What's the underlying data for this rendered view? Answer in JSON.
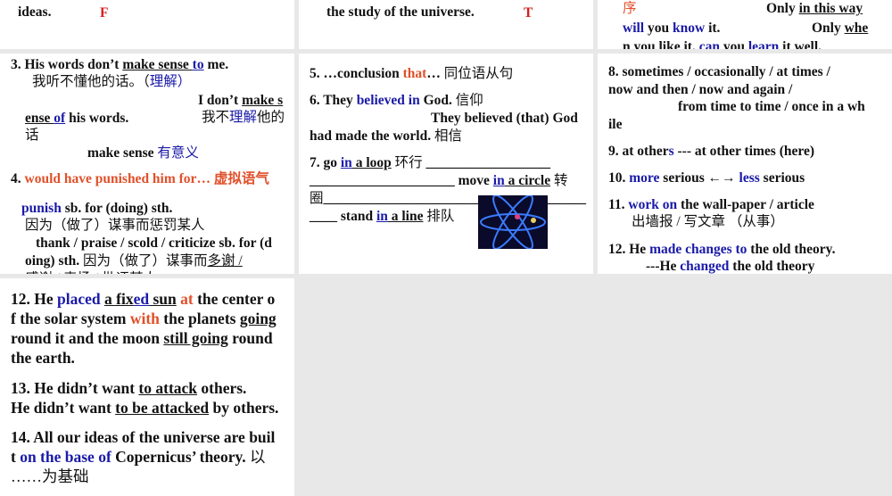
{
  "colors": {
    "blue": "#1a1aa8",
    "orange": "#e0502a",
    "red": "#d42020"
  },
  "panel_a": [
    [
      [
        "ideas.",
        ""
      ]
    ],
    [
      [
        "F",
        "r"
      ]
    ]
  ],
  "panel_b": [
    [
      [
        "the study of the universe.",
        ""
      ]
    ],
    [
      [
        "T",
        "r"
      ]
    ]
  ],
  "panel_c": [
    [
      [
        "序",
        "o cn"
      ]
    ],
    [
      [
        "Only ",
        ""
      ],
      [
        "in this way",
        "u"
      ]
    ],
    [
      [
        "will",
        "b"
      ],
      [
        " you ",
        ""
      ],
      [
        "know",
        "b"
      ],
      [
        " it.",
        ""
      ]
    ],
    [
      [
        "Only ",
        ""
      ],
      [
        "whe",
        "u"
      ]
    ],
    [
      [
        "n you like it, ",
        ""
      ],
      [
        "can",
        "b"
      ],
      [
        " you ",
        ""
      ],
      [
        "learn",
        "b"
      ],
      [
        " it well.",
        ""
      ]
    ]
  ],
  "panel_d": [
    [
      [
        "3. His words don’t ",
        ""
      ],
      [
        "make sense ",
        "u"
      ],
      [
        "to",
        "bu"
      ],
      [
        " me.",
        ""
      ]
    ],
    [
      [
        "我听不懂他的话。（",
        "cn"
      ],
      [
        "理解",
        "b cn"
      ],
      [
        "）",
        "b cn"
      ]
    ],
    [
      [
        "I don’t ",
        ""
      ],
      [
        "make s",
        "u"
      ]
    ],
    [
      [
        "ense ",
        "u"
      ],
      [
        "of",
        "bu"
      ],
      [
        " his words.",
        ""
      ]
    ],
    [
      [
        "我不",
        "cn"
      ],
      [
        "理解",
        "b cn"
      ],
      [
        "他的",
        "cn"
      ]
    ],
    [
      [
        "话",
        "cn"
      ]
    ],
    [
      [
        "make sense    ",
        ""
      ],
      [
        "有意义",
        "b cn"
      ]
    ],
    [
      [
        "4. ",
        ""
      ],
      [
        "would have punished him for… 虚拟语气",
        "o"
      ]
    ],
    [
      [
        "punish",
        "b"
      ],
      [
        " sb. for (doing) sth.",
        ""
      ]
    ],
    [
      [
        "因为（做了）谋事而惩罚某人",
        "cn"
      ]
    ],
    [
      [
        "thank / praise / scold / criticize sb. for (d",
        ""
      ]
    ],
    [
      [
        "oing) sth. ",
        ""
      ],
      [
        "因为（做了）谋事而",
        "cn"
      ],
      [
        "多谢  /",
        "u cn"
      ]
    ],
    [
      [
        "感谢 / 表扬 / 批评某人",
        "cn"
      ]
    ]
  ],
  "panel_e": [
    [
      [
        "5. …conclusion ",
        ""
      ],
      [
        "that",
        "o"
      ],
      [
        "… ",
        ""
      ],
      [
        "同位语从句",
        "cn"
      ]
    ],
    [
      [
        "6. They ",
        ""
      ],
      [
        "believed in",
        "b"
      ],
      [
        " God.     ",
        ""
      ],
      [
        "信仰",
        "cn"
      ]
    ],
    [
      [
        "They believed (that) God",
        ""
      ]
    ],
    [
      [
        "had made the world.  ",
        ""
      ],
      [
        "相信",
        "cn"
      ]
    ],
    [
      [
        "7. go ",
        ""
      ],
      [
        "in",
        "bu"
      ],
      [
        " a loop",
        "u"
      ],
      [
        "     ",
        ""
      ],
      [
        "环行",
        "cn"
      ],
      [
        "   __________________",
        ""
      ]
    ],
    [
      [
        "_____________________ move ",
        ""
      ],
      [
        "in",
        "bu"
      ],
      [
        " a circle",
        "u"
      ],
      [
        "  ",
        ""
      ],
      [
        "转",
        "cn"
      ]
    ],
    [
      [
        "圈",
        "cn"
      ],
      [
        "______________________________________",
        ""
      ]
    ],
    [
      [
        "____ stand ",
        ""
      ],
      [
        "in",
        "bu"
      ],
      [
        " a line",
        "u"
      ],
      [
        "     ",
        ""
      ],
      [
        "排队",
        "cn"
      ]
    ]
  ],
  "panel_f": [
    [
      [
        "8. sometimes / occasionally / at times /",
        ""
      ]
    ],
    [
      [
        "now and then / now and again /",
        ""
      ]
    ],
    [
      [
        "from time to time / once in a wh",
        ""
      ]
    ],
    [
      [
        "ile",
        ""
      ]
    ],
    [
      [
        "9. at other",
        ""
      ],
      [
        "s",
        "b"
      ],
      [
        " --- at other times      (here)",
        ""
      ]
    ],
    [
      [
        "10. ",
        ""
      ],
      [
        "more",
        "b"
      ],
      [
        " serious ←→ ",
        ""
      ],
      [
        "less",
        "b"
      ],
      [
        " serious",
        ""
      ]
    ],
    [
      [
        "11. ",
        ""
      ],
      [
        "work on",
        "b"
      ],
      [
        " the wall-paper / article",
        ""
      ]
    ],
    [
      [
        "出墙报  /  写文章    （从事）",
        "cn"
      ]
    ],
    [
      [
        "12. He ",
        ""
      ],
      [
        "made changes to",
        "b"
      ],
      [
        " the old theory.",
        ""
      ]
    ],
    [
      [
        "---He ",
        ""
      ],
      [
        "changed",
        "b"
      ],
      [
        " the old theory",
        ""
      ]
    ]
  ],
  "panel_g": [
    [
      [
        "12. He ",
        ""
      ],
      [
        "placed",
        "b"
      ],
      [
        " ",
        ""
      ],
      [
        "a fix",
        "u"
      ],
      [
        "ed",
        "bu"
      ],
      [
        " sun",
        "u"
      ],
      [
        " ",
        ""
      ],
      [
        "at",
        "o"
      ],
      [
        " the center o",
        ""
      ]
    ],
    [
      [
        "f the solar system ",
        ""
      ],
      [
        "with",
        "o"
      ],
      [
        " the planets ",
        ""
      ],
      [
        "going",
        "u"
      ]
    ],
    [
      [
        "round it and the moon ",
        ""
      ],
      [
        "still going",
        "u"
      ],
      [
        " round",
        ""
      ]
    ],
    [
      [
        "the earth.",
        ""
      ]
    ],
    [
      [
        "13. He didn’t want ",
        ""
      ],
      [
        "to attack",
        "u"
      ],
      [
        " others.",
        ""
      ]
    ],
    [
      [
        "He didn’t want ",
        ""
      ],
      [
        "to be attacked",
        "u"
      ],
      [
        " by others.",
        ""
      ]
    ],
    [
      [
        "14. All our ideas of the universe are buil",
        ""
      ]
    ],
    [
      [
        "t ",
        ""
      ],
      [
        "on the base of",
        "b"
      ],
      [
        " Copernicus’ theory.  ",
        ""
      ],
      [
        "以",
        "cn"
      ]
    ],
    [
      [
        "……为基础",
        "cn"
      ]
    ]
  ]
}
